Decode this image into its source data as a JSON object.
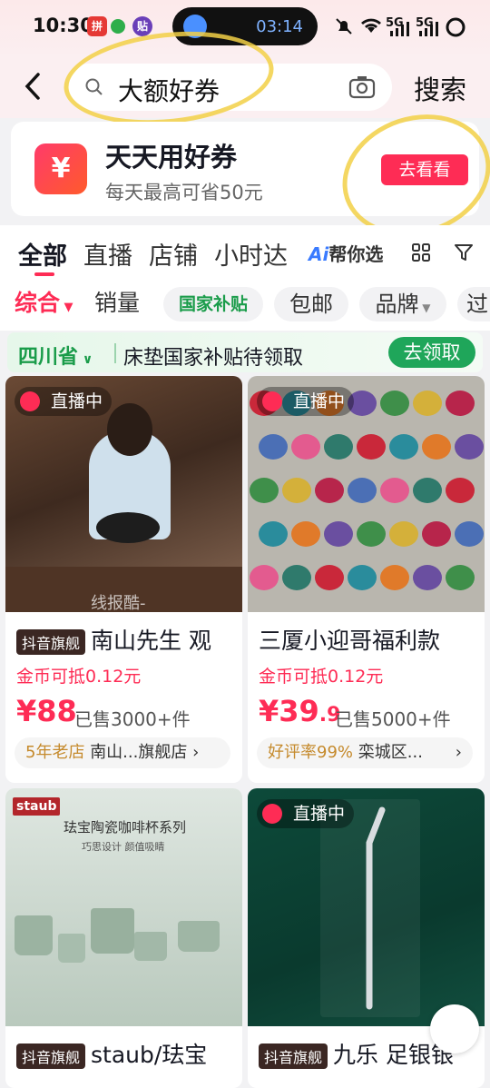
{
  "status_bar": {
    "time": "10:30",
    "timer": "03:14",
    "net1": "5G",
    "net2": "5G"
  },
  "header": {
    "query": "大额好券",
    "search_button": "搜索"
  },
  "promo": {
    "logo": "¥",
    "title": "天天用好券",
    "subtitle": "每天最高可省50元",
    "button": "去看看"
  },
  "tabs": {
    "items": [
      "全部",
      "直播",
      "店铺",
      "小时达"
    ],
    "ai_prefix": "Ai",
    "ai_label": "帮你选"
  },
  "sorts": {
    "comprehensive": "综合",
    "sales": "销量",
    "chips": [
      "国家补贴",
      "包邮",
      "品牌",
      "过"
    ]
  },
  "subsidy": {
    "province": "四川省",
    "text": "床垫国家补贴待领取",
    "button": "去领取"
  },
  "products": [
    {
      "live": "直播中",
      "badge": "抖音旗舰",
      "title": "南山先生 观",
      "coin": "金币可抵0.12元",
      "price": "¥88",
      "price_dec": "",
      "sold": "已售3000+件",
      "shop_hl": "5年老店",
      "shop": "南山...旗舰店",
      "watermark": "线报酷-new.xianbao.fun"
    },
    {
      "live": "直播中",
      "badge": "",
      "title": "三厦小迎哥福利款",
      "coin": "金币可抵0.12元",
      "price": "¥39",
      "price_dec": ".9",
      "sold": "已售5000+件",
      "shop_hl": "好评率99%",
      "shop": "栾城区..."
    },
    {
      "live": "",
      "badge": "抖音旗舰",
      "title": "staub/珐宝",
      "img_brand": "staub",
      "img_title": "珐宝陶瓷咖啡杯系列",
      "img_sub": "巧思设计 颜值吸睛"
    },
    {
      "live": "直播中",
      "badge": "抖音旗舰",
      "title": "九乐 足银银"
    }
  ],
  "colors": {
    "accent": "#fe2c55",
    "green": "#1fa65a"
  }
}
